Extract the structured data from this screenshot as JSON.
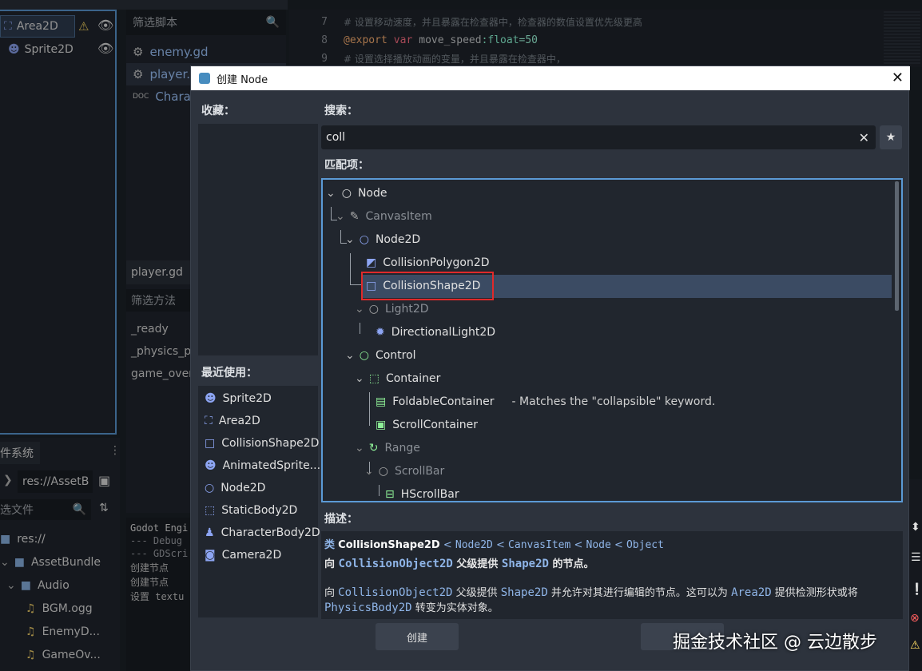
{
  "scene_dock": {
    "nodes": [
      {
        "label": "Area2D",
        "selected": true
      },
      {
        "label": "Sprite2D",
        "selected": false
      }
    ]
  },
  "script_panel": {
    "filter_placeholder": "筛选脚本",
    "scripts": [
      "enemy.gd",
      "player.gd",
      "Charact"
    ],
    "current_script": "player.gd",
    "method_filter_placeholder": "筛选方法",
    "methods": [
      "_ready",
      "_physics_pr",
      "game_over"
    ]
  },
  "code_editor": {
    "lines": [
      {
        "number": "7",
        "text": "#  设置移动速度，并且暴露在检查器中，检查器的数值设置优先级更高"
      },
      {
        "number": "8",
        "annotation": "@export",
        "keyword": "var",
        "name": "move_speed",
        "type": ":float",
        "value": "=50"
      },
      {
        "number": "9",
        "text": "#  设置选择播放动画的变量，并且暴露在检查器中，"
      }
    ]
  },
  "filesystem": {
    "tab_label": "件系统",
    "path": "res://AssetB",
    "filter_placeholder": "选文件",
    "items": [
      {
        "label": "res://",
        "type": "folder"
      },
      {
        "label": "AssetBundle",
        "type": "folder"
      },
      {
        "label": "Audio",
        "type": "folder"
      },
      {
        "label": "BGM.ogg",
        "type": "audio"
      },
      {
        "label": "EnemyD...",
        "type": "audio"
      },
      {
        "label": "GameOv...",
        "type": "audio"
      }
    ]
  },
  "output": {
    "lines": [
      "Godot Engi",
      "--- Debug",
      "--- GDScri",
      "创建节点",
      "创建节点",
      "设置 textu"
    ]
  },
  "dialog": {
    "title": "创建 Node",
    "favorites_label": "收藏：",
    "recent_label": "最近使用：",
    "recent_items": [
      {
        "label": "Sprite2D",
        "icon": "sprite2d-icon"
      },
      {
        "label": "Area2D",
        "icon": "area2d-icon"
      },
      {
        "label": "CollisionShape2D",
        "icon": "collisionshape2d-icon"
      },
      {
        "label": "AnimatedSprite...",
        "icon": "animatedsprite-icon"
      },
      {
        "label": "Node2D",
        "icon": "node2d-icon"
      },
      {
        "label": "StaticBody2D",
        "icon": "staticbody2d-icon"
      },
      {
        "label": "CharacterBody2D",
        "icon": "characterbody2d-icon"
      },
      {
        "label": "Camera2D",
        "icon": "camera2d-icon"
      }
    ],
    "search_label": "搜索：",
    "search_value": "coll",
    "matches_label": "匹配项：",
    "tree": [
      {
        "label": "Node",
        "dim": false
      },
      {
        "label": "CanvasItem",
        "dim": true
      },
      {
        "label": "Node2D",
        "dim": false
      },
      {
        "label": "CollisionPolygon2D",
        "dim": false
      },
      {
        "label": "CollisionShape2D",
        "dim": false,
        "selected": true
      },
      {
        "label": "Light2D",
        "dim": true
      },
      {
        "label": "DirectionalLight2D",
        "dim": false
      },
      {
        "label": "Control",
        "dim": false
      },
      {
        "label": "Container",
        "dim": false
      },
      {
        "label": "FoldableContainer",
        "dim": false,
        "note": "- Matches the \"collapsible\" keyword."
      },
      {
        "label": "ScrollContainer",
        "dim": false
      },
      {
        "label": "Range",
        "dim": true
      },
      {
        "label": "ScrollBar",
        "dim": true
      },
      {
        "label": "HScrollBar",
        "dim": false
      }
    ],
    "description_label": "描述：",
    "description": {
      "class_prefix": "类",
      "class_name": "CollisionShape2D",
      "inheritance": [
        "Node2D",
        "CanvasItem",
        "Node",
        "Object"
      ],
      "brief_1": "向",
      "brief_link_1": "CollisionObject2D",
      "brief_2": "父级提供",
      "brief_link_2": "Shape2D",
      "brief_3": "的节点。",
      "full_1": "向",
      "full_link_1": "CollisionObject2D",
      "full_2": "父级提供",
      "full_link_2": "Shape2D",
      "full_3": "并允许对其进行编辑的节点。这可以为",
      "full_link_3": "Area2D",
      "full_4": "提供检测形状或将",
      "full_link_4": "PhysicsBody2D",
      "full_5": "转变为实体对象。"
    },
    "create_button": "创建",
    "cancel_button": ""
  },
  "watermark": "掘金技术社区 @ 云边散步",
  "colors": {
    "accent": "#5b9ad6",
    "highlight_box": "#e02a2a",
    "selected_row": "#3b4b63",
    "node_icon_circle": "#e0e0e0",
    "node2d_icon": "#8da5f3",
    "control_icon": "#8eef97"
  }
}
